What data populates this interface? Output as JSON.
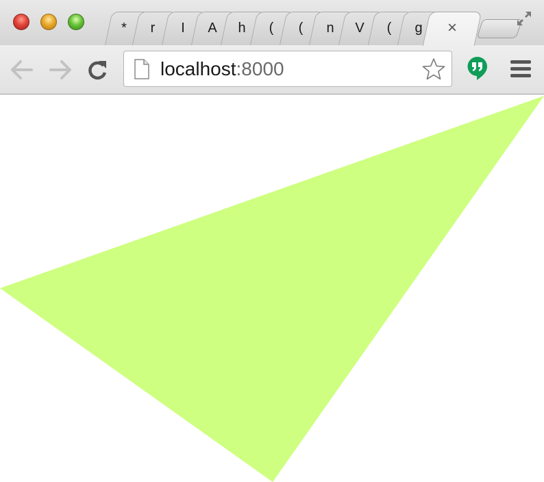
{
  "window": {
    "controls": [
      "close",
      "minimize",
      "zoom"
    ]
  },
  "tabs": [
    {
      "label": "*"
    },
    {
      "label": "r"
    },
    {
      "label": "I"
    },
    {
      "label": "A"
    },
    {
      "label": "h"
    },
    {
      "label": "("
    },
    {
      "label": "("
    },
    {
      "label": "n"
    },
    {
      "label": "V"
    },
    {
      "label": "("
    },
    {
      "label": "g"
    }
  ],
  "active_tab": {
    "close_label": "×"
  },
  "omnibox": {
    "host": "localhost",
    "port": ":8000"
  },
  "icons": {
    "back": "back-arrow-icon",
    "forward": "forward-arrow-icon",
    "reload": "reload-icon",
    "page": "page-icon",
    "bookmark": "star-icon",
    "hangouts": "hangouts-icon",
    "menu": "hamburger-menu-icon",
    "fullscreen": "fullscreen-icon"
  },
  "colors": {
    "triangle": "#ceff80",
    "hangouts": "#0f9d58"
  }
}
